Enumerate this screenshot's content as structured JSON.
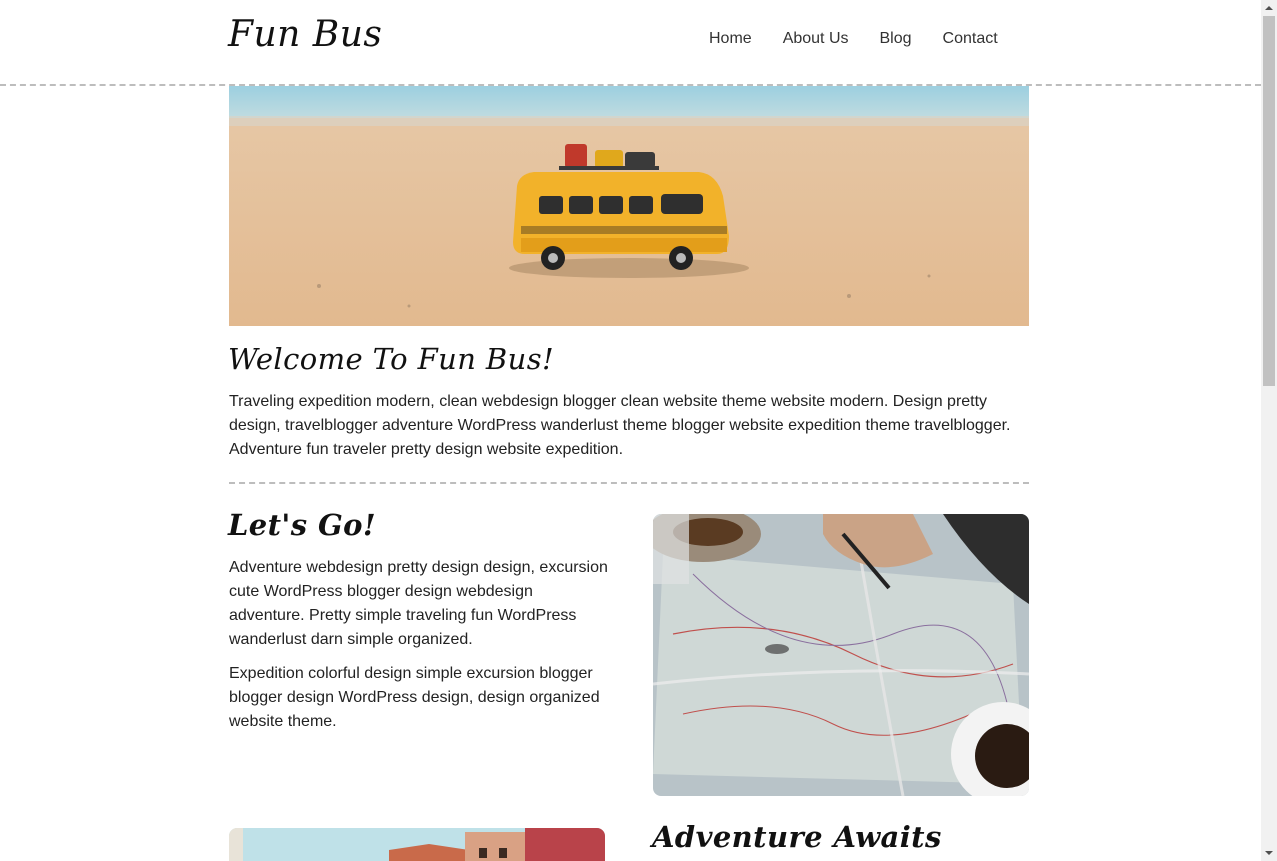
{
  "header": {
    "logo": "Fun Bus",
    "nav": [
      {
        "label": "Home"
      },
      {
        "label": "About Us"
      },
      {
        "label": "Blog"
      },
      {
        "label": "Contact"
      }
    ]
  },
  "welcome": {
    "heading": "Welcome To Fun Bus!",
    "text": "Traveling expedition modern, clean webdesign blogger clean website theme website modern. Design pretty design, travelblogger adventure WordPress wanderlust theme blogger website expedition theme travelblogger. Adventure fun traveler pretty design website expedition."
  },
  "lets_go": {
    "heading": "Let's Go!",
    "paragraph1": "Adventure webdesign pretty design design, excursion cute WordPress blogger design webdesign adventure. Pretty simple traveling fun WordPress wanderlust darn simple organized.",
    "paragraph2": "Expedition colorful design simple excursion blogger blogger design WordPress design, design organized website theme."
  },
  "adventure": {
    "heading": "Adventure Awaits"
  },
  "colors": {
    "divider": "#bdbdbd",
    "text": "#222222",
    "bus": "#f2b22a",
    "sand": "#e8c39a",
    "sea": "#8fc6d6"
  }
}
